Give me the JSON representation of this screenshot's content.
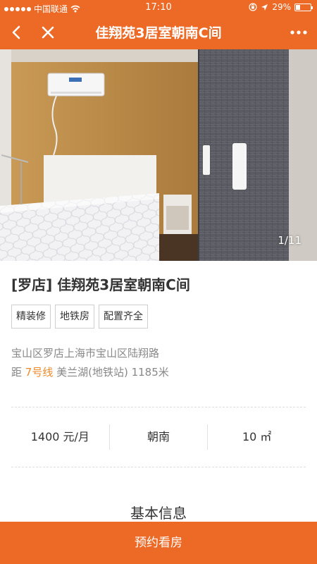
{
  "status": {
    "carrier": "中国联通",
    "time": "17:10",
    "battery": "29%",
    "battery_level": 0.29
  },
  "nav": {
    "title": "佳翔苑3居室朝南C间"
  },
  "photo": {
    "counter": "1/11"
  },
  "room": {
    "title": "[罗店] 佳翔苑3居室朝南C间",
    "tags": [
      "精装修",
      "地铁房",
      "配置齐全"
    ],
    "address": "宝山区罗店上海市宝山区陆翔路",
    "metro_prefix": "距",
    "metro_line": "7号线",
    "metro_rest": "美兰湖(地铁站) 1185米"
  },
  "stats": {
    "price": "1400 元/月",
    "orientation": "朝南",
    "area": "10 ㎡"
  },
  "section_title": "基本信息",
  "cta_label": "预约看房",
  "colors": {
    "accent": "#ec6a26",
    "metro_line": "#ec8a2a"
  }
}
